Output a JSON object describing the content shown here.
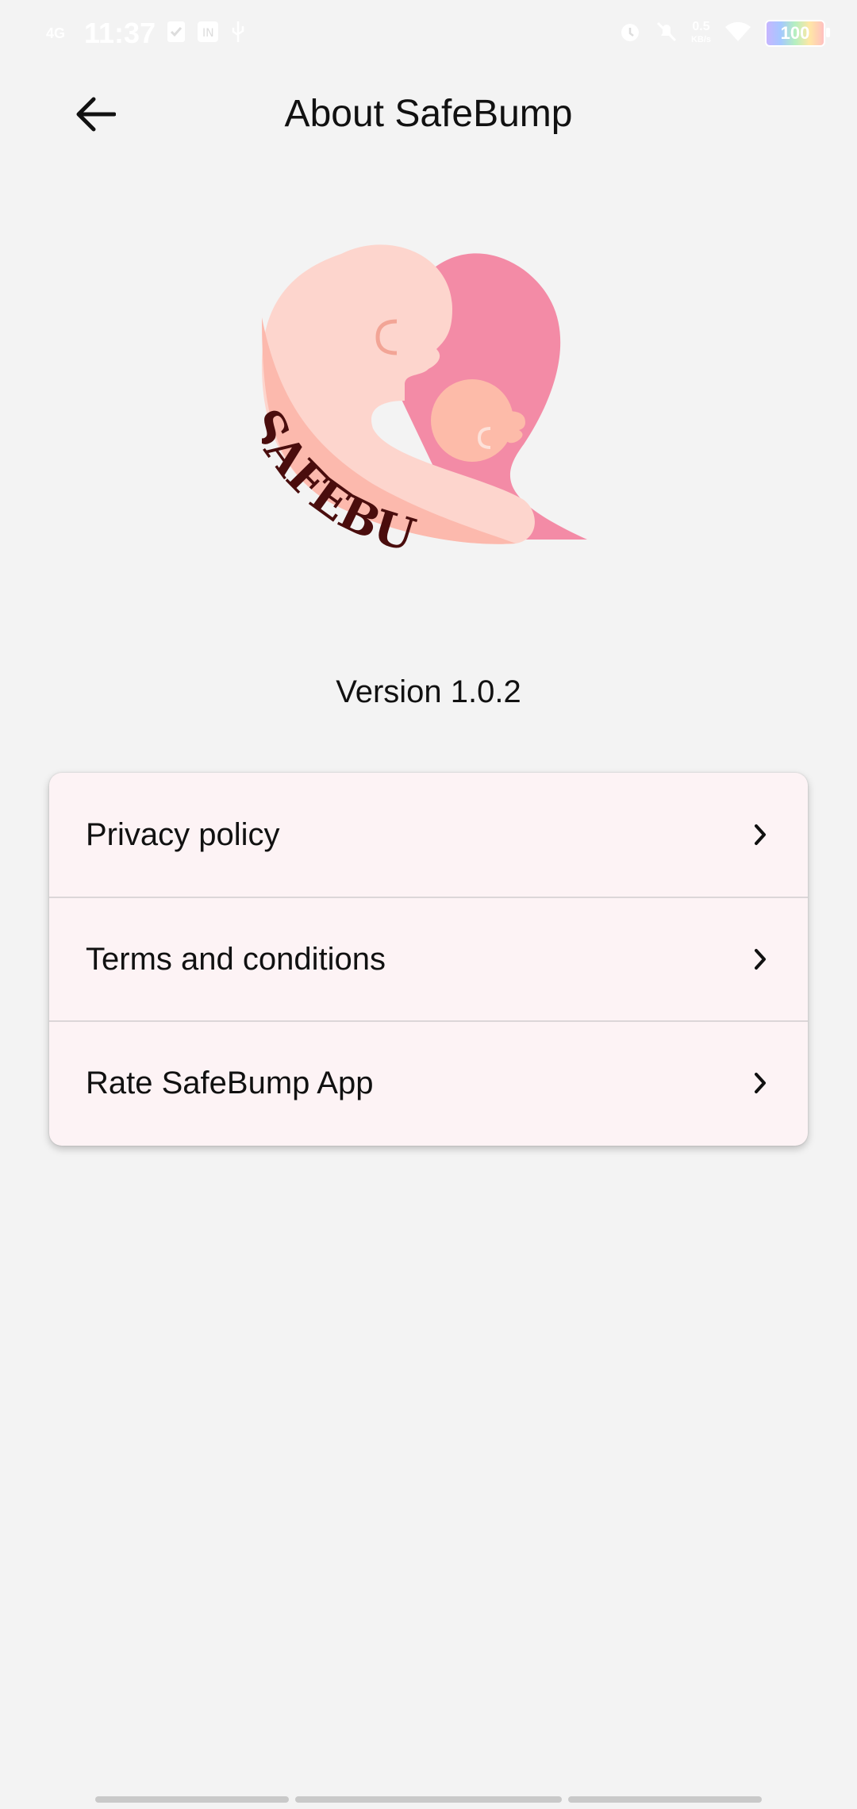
{
  "status_bar": {
    "network": "4G",
    "time": "11:37",
    "speed_value": "0.5",
    "speed_unit": "KB/s",
    "battery": "100"
  },
  "app_bar": {
    "title": "About SafeBump"
  },
  "logo": {
    "brand_text": "SAFEBUMP"
  },
  "version_text": "Version 1.0.2",
  "menu": {
    "items": [
      {
        "label": "Privacy policy"
      },
      {
        "label": "Terms and conditions"
      },
      {
        "label": "Rate SafeBump App"
      }
    ]
  },
  "colors": {
    "background": "#f3f3f3",
    "card": "#fdf3f5",
    "logo_heart": "#f38ba6",
    "logo_skin": "#fdd5cd",
    "logo_text": "#4a0d0d"
  }
}
